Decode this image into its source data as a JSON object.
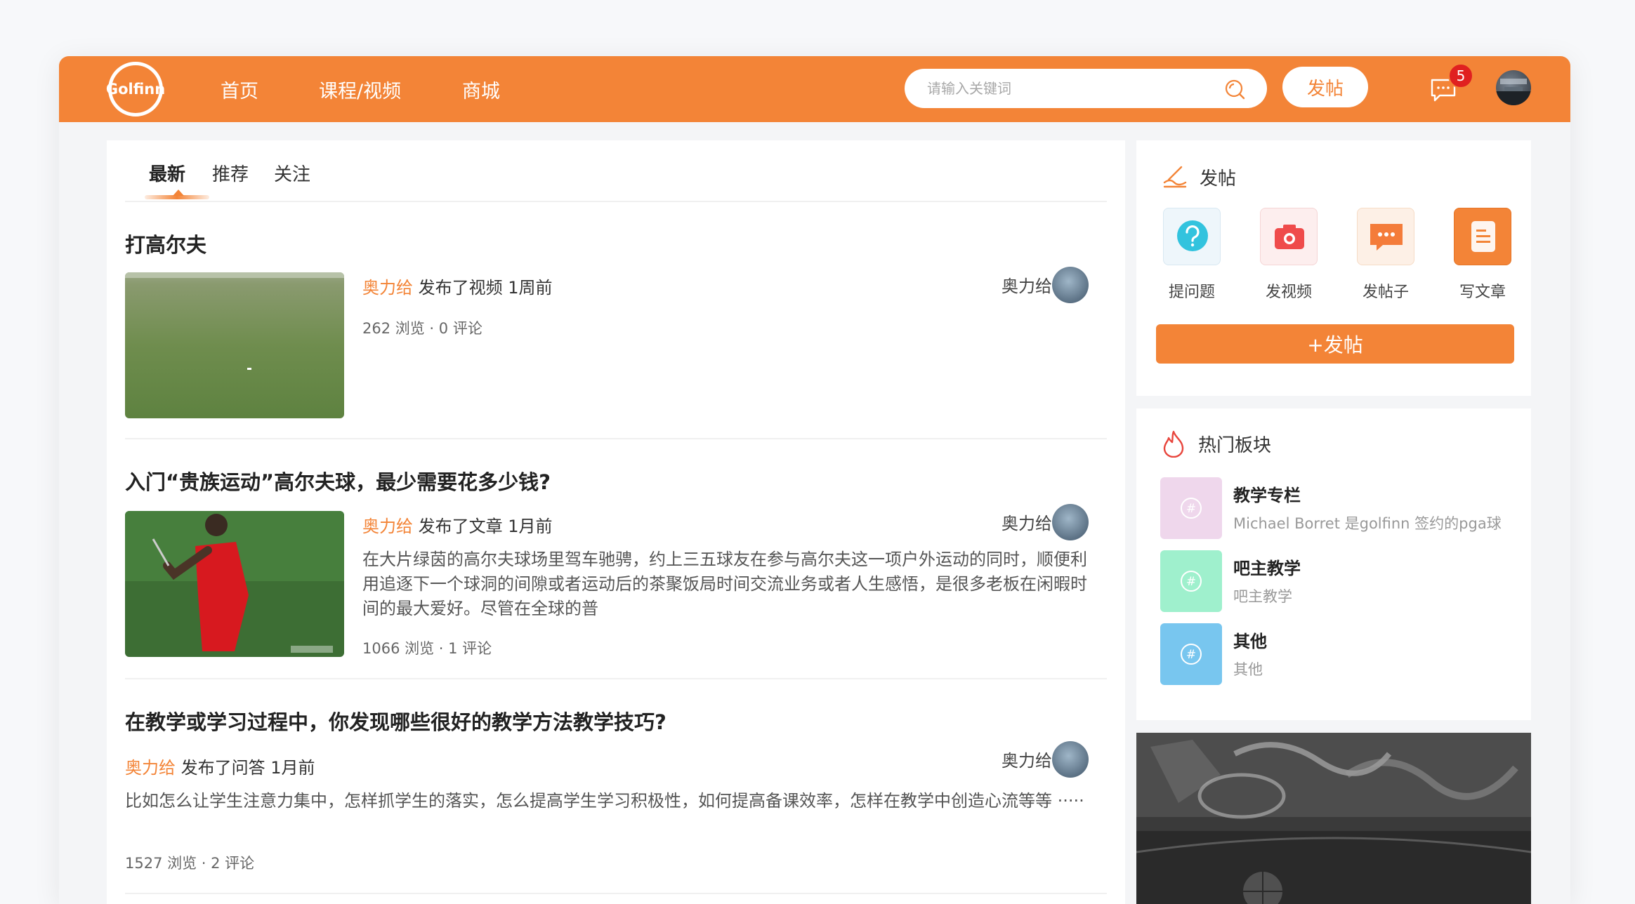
{
  "header": {
    "logo_text": "Golfinn",
    "nav": [
      "首页",
      "课程/视频",
      "商城"
    ],
    "search_placeholder": "请输入关键词",
    "post_button": "发帖",
    "message_count": "5",
    "brand_color": "#f38437"
  },
  "tabs": [
    "最新",
    "推荐",
    "关注"
  ],
  "posts": [
    {
      "title": "打高尔夫",
      "author": "奥力给",
      "action": "发布了视频 1周前",
      "stats": "262 浏览 · 0 评论",
      "right_author": "奥力给"
    },
    {
      "title": "入门“贵族运动”高尔夫球，最少需要花多少钱?",
      "author": "奥力给",
      "action": "发布了文章 1月前",
      "excerpt": "在大片绿茵的高尔夫球场里驾车驰骋，约上三五球友在参与高尔夫这一项户外运动的同时，顺便利用追逐下一个球洞的间隙或者运动后的茶聚饭局时间交流业务或者人生感悟，是很多老板在闲暇时间的最大爱好。尽管在全球的普",
      "stats": "1066 浏览 · 1 评论",
      "right_author": "奥力给"
    },
    {
      "title": "在教学或学习过程中，你发现哪些很好的教学方法教学技巧?",
      "author": "奥力给",
      "action": "发布了问答 1月前",
      "excerpt": "比如怎么让学生注意力集中，怎样抓学生的落实，怎么提高学生学习积极性，如何提高备课效率，怎样在教学中创造心流等等 ·····",
      "stats": "1527 浏览 · 2 评论",
      "right_author": "奥力给"
    }
  ],
  "sidebar": {
    "post_card": {
      "title": "发帖",
      "types": [
        "提问题",
        "发视频",
        "发帖子",
        "写文章"
      ],
      "button": "+发帖"
    },
    "hot_forums": {
      "title": "热门板块",
      "items": [
        {
          "name": "教学专栏",
          "desc": "Michael Borret 是golfinn 签约的pga球",
          "color": "#efd7ec"
        },
        {
          "name": "吧主教学",
          "desc": "吧主教学",
          "color": "#9ff0cd"
        },
        {
          "name": "其他",
          "desc": "其他",
          "color": "#78c6ef"
        }
      ]
    }
  }
}
